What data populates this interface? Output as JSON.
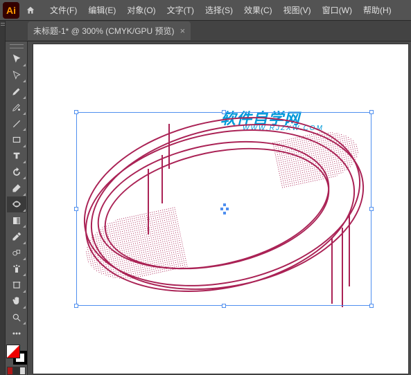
{
  "app": {
    "short": "Ai"
  },
  "menu": {
    "file": "文件(F)",
    "edit": "编辑(E)",
    "object": "对象(O)",
    "type": "文字(T)",
    "select": "选择(S)",
    "effect": "效果(C)",
    "view": "视图(V)",
    "window": "窗口(W)",
    "help": "帮助(H)"
  },
  "tab": {
    "title": "未标题-1* @ 300% (CMYK/GPU 预览)",
    "close": "×"
  },
  "watermark": {
    "title": "软件自学网",
    "url": "WWW.RJZXW.COM"
  },
  "tools": [
    "selection-tool",
    "direct-selection-tool",
    "pen-tool",
    "curvature-tool",
    "line-tool",
    "rectangle-tool",
    "type-tool",
    "rotate-tool",
    "eraser-tool",
    "width-tool",
    "gradient-tool",
    "eyedropper-tool",
    "blend-tool",
    "symbol-sprayer-tool",
    "artboard-tool",
    "hand-tool",
    "zoom-tool"
  ],
  "swatches": {
    "a": "#b01818",
    "b": "#303030",
    "c": "#d8d8d8"
  }
}
